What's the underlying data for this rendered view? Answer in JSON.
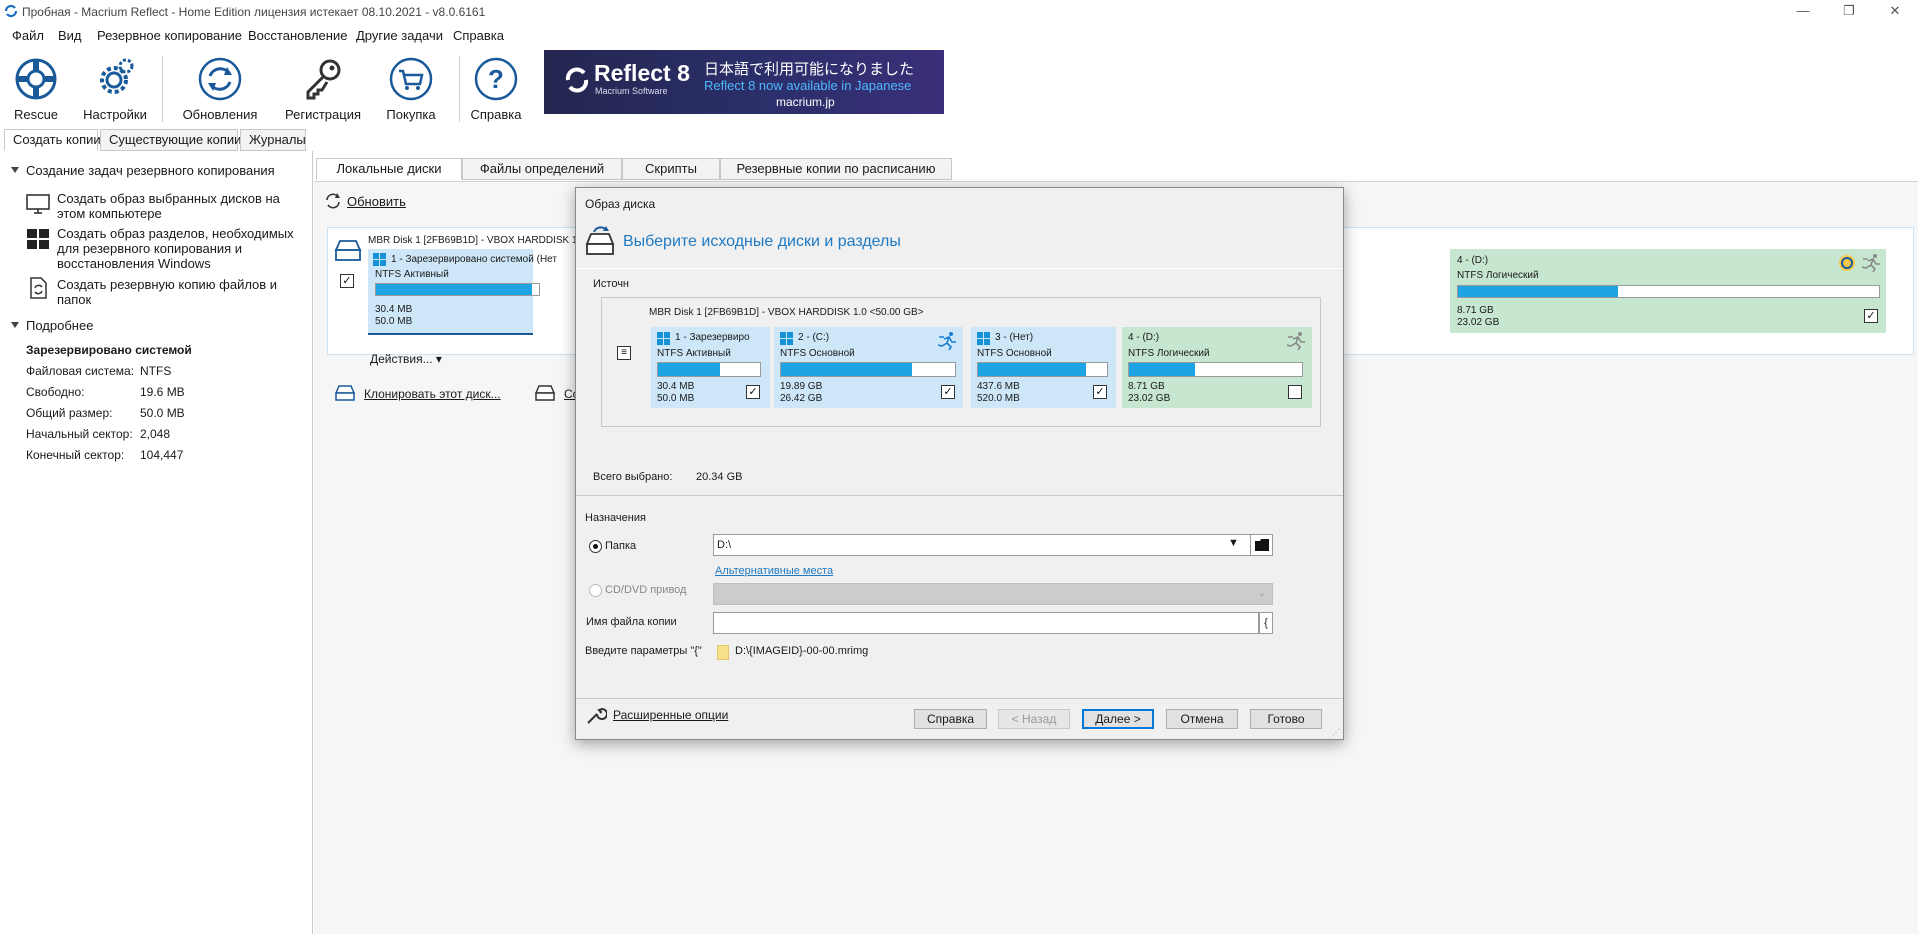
{
  "window": {
    "title": "Пробная - Macrium Reflect - Home Edition лицензия истекает 08.10.2021 - v8.0.6161",
    "minimize": "—",
    "maximize": "❐",
    "close": "✕"
  },
  "menu": [
    "Файл",
    "Вид",
    "Резервное копирование",
    "Восстановление",
    "Другие задачи",
    "Справка"
  ],
  "toolbar": {
    "rescue": "Rescue",
    "settings": "Настройки",
    "updates": "Обновления",
    "registration": "Регистрация",
    "purchase": "Покупка",
    "help": "Справка"
  },
  "banner": {
    "product": "Reflect 8",
    "company": "Macrium Software",
    "jp_text": "日本語で利用可能になりました",
    "en_text": "Reflect 8 now available in Japanese",
    "url": "macrium.jp"
  },
  "left_tabs": [
    "Создать копии",
    "Существующие копии",
    "Журналы"
  ],
  "left_panel": {
    "tasks_header": "Создание задач резервного копирования",
    "tasks": [
      "Создать образ выбранных дисков на этом компьютере",
      "Создать образ разделов, необходимых для резервного копирования и восстановления Windows",
      "Создать резервную копию файлов и папок"
    ],
    "details_header": "Подробнее",
    "details_title": "Зарезервировано системой",
    "props": [
      {
        "k": "Файловая система:",
        "v": "NTFS"
      },
      {
        "k": "Свободно:",
        "v": "19.6 MB"
      },
      {
        "k": "Общий размер:",
        "v": "50.0 MB"
      },
      {
        "k": "Начальный сектор:",
        "v": "2,048"
      },
      {
        "k": "Конечный сектор:",
        "v": "104,447"
      }
    ]
  },
  "main_tabs": [
    "Локальные диски",
    "Файлы определений",
    "Скрипты",
    "Резервные копии по расписанию"
  ],
  "main": {
    "refresh": "Обновить",
    "disk_title": "MBR Disk 1 [2FB69B1D] - VBOX HARDDISK 1",
    "p1_title": "1 - Зарезервировано системой (Нет",
    "p1_fs": "NTFS Активный",
    "p1_used": "30.4 MB",
    "p1_size": "50.0 MB",
    "actions": "Действия...",
    "p4_title": "4 - (D:)",
    "p4_fs": "NTFS Логический",
    "p4_used": "8.71 GB",
    "p4_size": "23.02 GB",
    "clone": "Клонировать этот диск...",
    "image_partial": "Со"
  },
  "dialog": {
    "title": "Образ диска",
    "heading": "Выберите исходные диски и разделы",
    "source_label": "Источн",
    "disk_title": "MBR Disk 1 [2FB69B1D] - VBOX HARDDISK 1.0  <50.00 GB>",
    "partitions": [
      {
        "title": "1 - Зарезервиро",
        "fs": "NTFS Активный",
        "used": "30.4 MB",
        "size": "50.0 MB",
        "fill": 0.61,
        "checked": true
      },
      {
        "title": "2 - (C:)",
        "fs": "NTFS Основной",
        "used": "19.89 GB",
        "size": "26.42 GB",
        "fill": 0.75,
        "checked": true
      },
      {
        "title": "3 - (Нет)",
        "fs": "NTFS Основной",
        "used": "437.6 MB",
        "size": "520.0 MB",
        "fill": 0.84,
        "checked": true
      },
      {
        "title": "4 - (D:)",
        "fs": "NTFS Логический",
        "used": "8.71 GB",
        "size": "23.02 GB",
        "fill": 0.38,
        "checked": false
      }
    ],
    "total_label": "Всего выбрано:",
    "total_value": "20.34 GB",
    "dest_header": "Назначения",
    "folder_label": "Папка",
    "folder_value": "D:\\",
    "alt_locations": "Альтернативные места",
    "cd_label": "CD/DVD привод",
    "filename_label": "Имя файла копии",
    "filename_brace": "{",
    "params_label": "Введите параметры \"{\"",
    "params_value": "D:\\{IMAGEID}-00-00.mrimg",
    "advanced": "Расширенные опции",
    "buttons": {
      "help": "Справка",
      "back": "< Назад",
      "next": "Далее >",
      "cancel": "Отмена",
      "finish": "Готово"
    }
  },
  "colors": {
    "accent": "#1ea3e4",
    "partition_primary_bg": "#cde7f9",
    "partition_logical_bg": "#c6e6cf",
    "heading_blue": "#1f7ac4"
  }
}
